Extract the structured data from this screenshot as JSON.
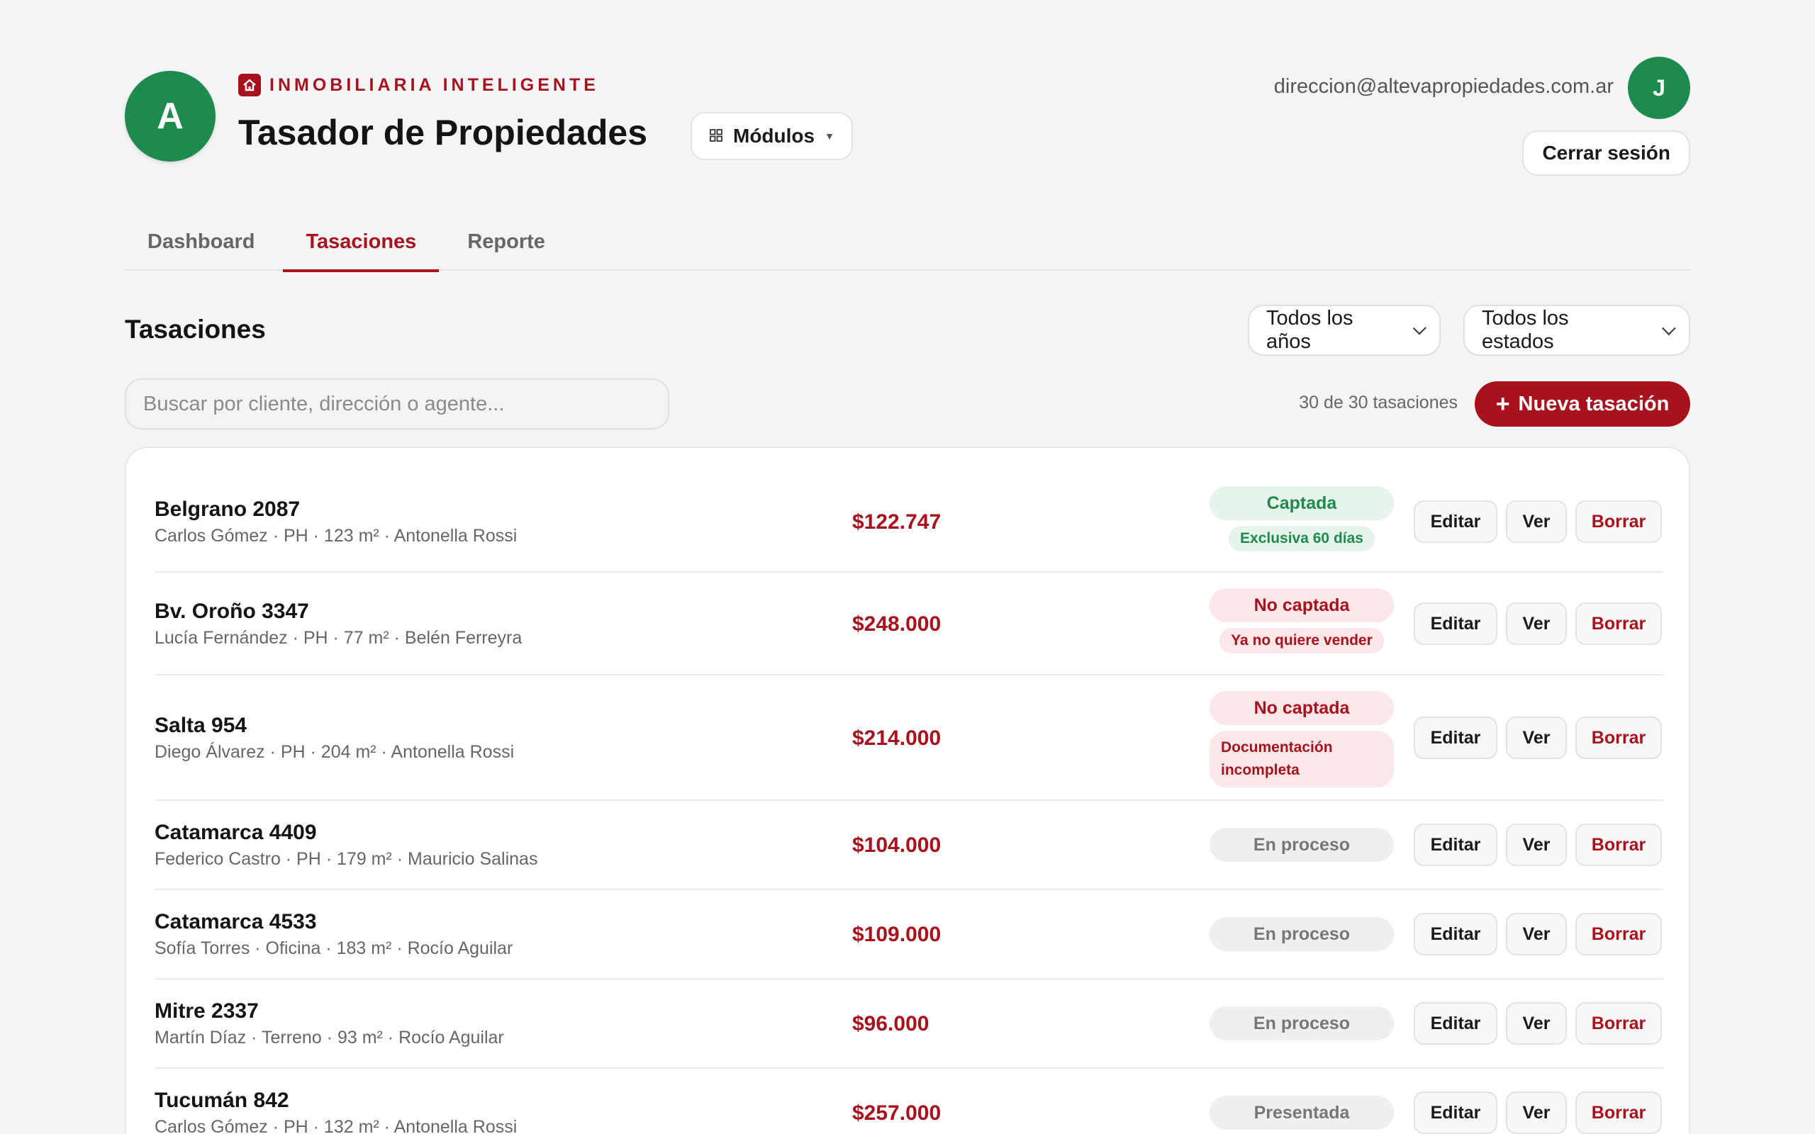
{
  "brand": {
    "avatar_letter": "A",
    "tagline": "INMOBILIARIA INTELIGENTE",
    "app_title": "Tasador de Propiedades",
    "modules_label": "Módulos"
  },
  "user": {
    "email": "direccion@altevapropiedades.com.ar",
    "avatar_letter": "J",
    "logout_label": "Cerrar sesión"
  },
  "tabs": [
    {
      "label": "Dashboard",
      "active": false
    },
    {
      "label": "Tasaciones",
      "active": true
    },
    {
      "label": "Reporte",
      "active": false
    }
  ],
  "section": {
    "title": "Tasaciones",
    "filter_year": "Todos los años",
    "filter_state": "Todos los estados",
    "search_placeholder": "Buscar por cliente, dirección o agente...",
    "count_text": "30 de 30 tasaciones",
    "new_button": "Nueva tasación"
  },
  "actions": {
    "edit": "Editar",
    "view": "Ver",
    "delete": "Borrar"
  },
  "rows": [
    {
      "address": "Belgrano 2087",
      "meta": "Carlos Gómez · PH · 123 m² · Antonella Rossi",
      "price": "$122.747",
      "status": "Captada",
      "status_color": "green",
      "sub": "Exclusiva 60 días"
    },
    {
      "address": "Bv. Oroño 3347",
      "meta": "Lucía Fernández · PH · 77 m² · Belén Ferreyra",
      "price": "$248.000",
      "status": "No captada",
      "status_color": "red",
      "sub": "Ya no quiere vender"
    },
    {
      "address": "Salta 954",
      "meta": "Diego Álvarez · PH · 204 m² · Antonella Rossi",
      "price": "$214.000",
      "status": "No captada",
      "status_color": "red",
      "sub": "Documentación incompleta"
    },
    {
      "address": "Catamarca 4409",
      "meta": "Federico Castro · PH · 179 m² · Mauricio Salinas",
      "price": "$104.000",
      "status": "En proceso",
      "status_color": "gray",
      "sub": ""
    },
    {
      "address": "Catamarca 4533",
      "meta": "Sofía Torres · Oficina · 183 m² · Rocío Aguilar",
      "price": "$109.000",
      "status": "En proceso",
      "status_color": "gray",
      "sub": ""
    },
    {
      "address": "Mitre 2337",
      "meta": "Martín Díaz · Terreno · 93 m² · Rocío Aguilar",
      "price": "$96.000",
      "status": "En proceso",
      "status_color": "gray",
      "sub": ""
    },
    {
      "address": "Tucumán 842",
      "meta": "Carlos Gómez · PH · 132 m² · Antonella Rossi",
      "price": "$257.000",
      "status": "Presentada",
      "status_color": "gray",
      "sub": ""
    }
  ],
  "colors": {
    "brand_red": "#a8121d",
    "brand_green": "#1e8a4c",
    "background": "#f3f4f6"
  }
}
